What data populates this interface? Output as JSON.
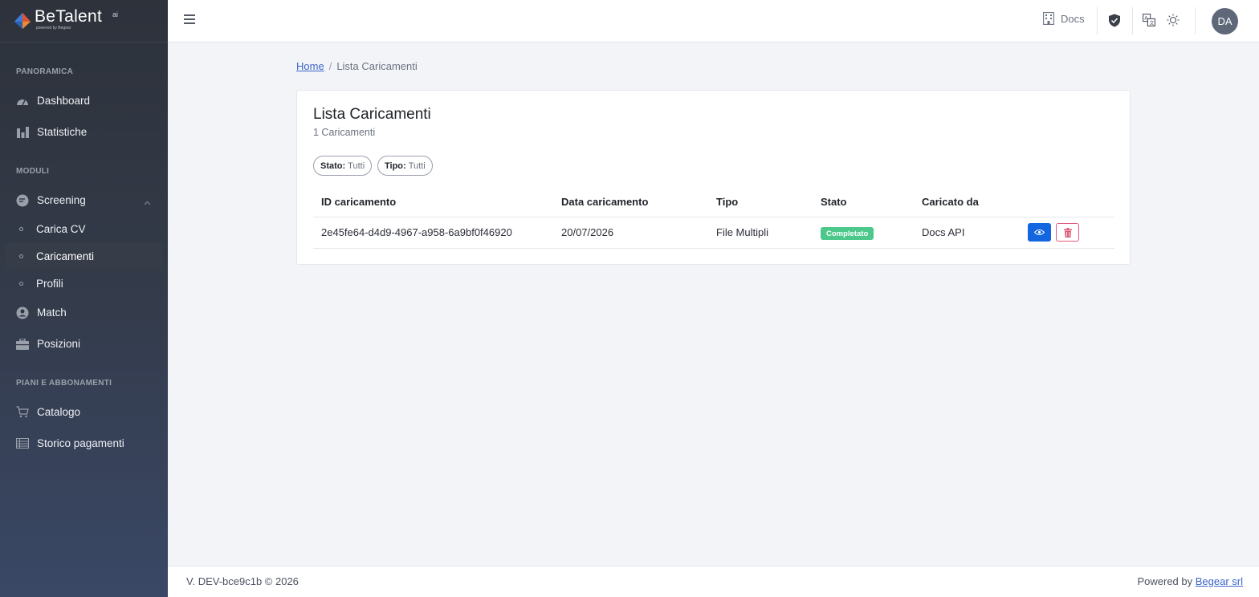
{
  "brand": {
    "name": "BeTalent",
    "ai": "ai",
    "sub": "powered by Begear"
  },
  "sidebar": {
    "sections": {
      "overview": "PANORAMICA",
      "modules": "MODULI",
      "plans": "PIANI E ABBONAMENTI"
    },
    "items": {
      "dashboard": "Dashboard",
      "statistics": "Statistiche",
      "screening": "Screening",
      "upload_cv": "Carica CV",
      "uploads": "Caricamenti",
      "profiles": "Profili",
      "match": "Match",
      "positions": "Posizioni",
      "catalog": "Catalogo",
      "payment_history": "Storico pagamenti"
    }
  },
  "topbar": {
    "docs_label": "Docs",
    "avatar_initials": "DA"
  },
  "breadcrumb": {
    "home": "Home",
    "current": "Lista Caricamenti"
  },
  "page": {
    "title": "Lista Caricamenti",
    "subtitle": "1 Caricamenti",
    "filters": {
      "status_label": "Stato:",
      "status_value": "Tutti",
      "type_label": "Tipo:",
      "type_value": "Tutti"
    },
    "table": {
      "headers": {
        "id": "ID caricamento",
        "date": "Data caricamento",
        "type": "Tipo",
        "status": "Stato",
        "uploaded_by": "Caricato da"
      },
      "rows": [
        {
          "id": "2e45fe64-d4d9-4967-a958-6a9bf0f46920",
          "date": "20/07/2026",
          "type": "File Multipli",
          "status": "Completato",
          "uploaded_by": "Docs API"
        }
      ]
    }
  },
  "footer": {
    "version": "V. DEV-bce9c1b © 2026",
    "powered_by": "Powered by",
    "company": "Begear srl"
  },
  "colors": {
    "primary": "#1366e0",
    "success": "#4cc98a",
    "danger": "#e05a7a",
    "link": "#3a64c8"
  }
}
